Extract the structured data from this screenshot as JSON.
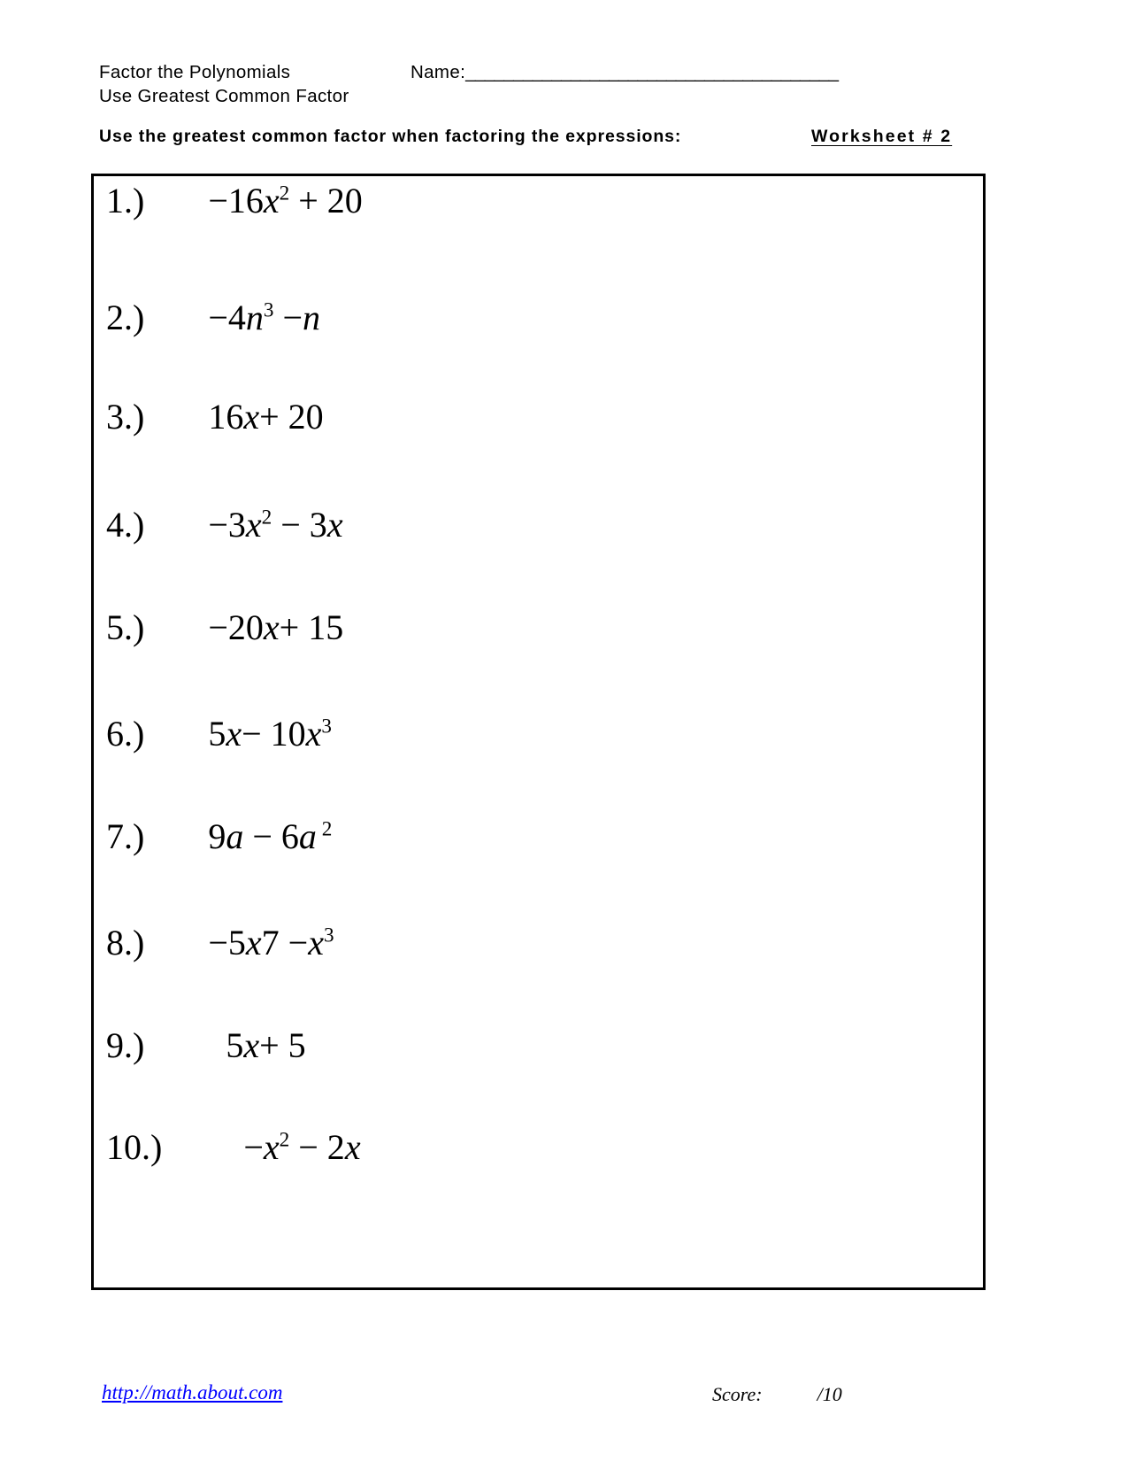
{
  "header": {
    "title_line_1": "Factor the Polynomials",
    "title_line_2": "Use Greatest Common Factor",
    "name_label": "Name:",
    "name_rule": "_______________________________________"
  },
  "instruction": {
    "text": "Use the greatest common factor when factoring the expressions:",
    "worksheet_label": "Worksheet # 2"
  },
  "problems": [
    {
      "number": "1.)",
      "expression": "−16x² + 20",
      "parts": [
        {
          "text": "−16",
          "style": "normal"
        },
        {
          "text": "x",
          "style": "italic"
        },
        {
          "text": "2",
          "style": "sup"
        },
        {
          "text": " + 20",
          "style": "normal"
        }
      ]
    },
    {
      "number": "2.)",
      "expression": "−4n³ −n",
      "parts": [
        {
          "text": "−4",
          "style": "normal"
        },
        {
          "text": "n",
          "style": "italic"
        },
        {
          "text": "3",
          "style": "sup"
        },
        {
          "text": " −",
          "style": "normal"
        },
        {
          "text": "n",
          "style": "italic"
        }
      ]
    },
    {
      "number": "3.)",
      "expression": "16x+ 20",
      "parts": [
        {
          "text": "16",
          "style": "normal"
        },
        {
          "text": "x",
          "style": "italic"
        },
        {
          "text": "+ 20",
          "style": "normal"
        }
      ]
    },
    {
      "number": "4.)",
      "expression": "−3x² − 3x",
      "parts": [
        {
          "text": "−3",
          "style": "normal"
        },
        {
          "text": "x",
          "style": "italic"
        },
        {
          "text": "2",
          "style": "sup"
        },
        {
          "text": " − 3",
          "style": "normal"
        },
        {
          "text": "x",
          "style": "italic"
        }
      ]
    },
    {
      "number": "5.)",
      "expression": "−20x+ 15",
      "parts": [
        {
          "text": "−20",
          "style": "normal"
        },
        {
          "text": "x",
          "style": "italic"
        },
        {
          "text": "+ 15",
          "style": "normal"
        }
      ]
    },
    {
      "number": "6.)",
      "expression": "5x− 10x³",
      "parts": [
        {
          "text": "5",
          "style": "normal"
        },
        {
          "text": "x",
          "style": "italic"
        },
        {
          "text": "− 10",
          "style": "normal"
        },
        {
          "text": "x",
          "style": "italic"
        },
        {
          "text": "3",
          "style": "sup"
        }
      ]
    },
    {
      "number": "7.)",
      "expression": "9a − 6a ²",
      "parts": [
        {
          "text": "9",
          "style": "normal"
        },
        {
          "text": "a",
          "style": "italic"
        },
        {
          "text": " − 6",
          "style": "normal"
        },
        {
          "text": "a",
          "style": "italic"
        },
        {
          "text": " 2",
          "style": "sup"
        }
      ]
    },
    {
      "number": "8.)",
      "expression": "−5x7 −x³",
      "parts": [
        {
          "text": "−5",
          "style": "normal"
        },
        {
          "text": "x",
          "style": "italic"
        },
        {
          "text": "7 −",
          "style": "normal"
        },
        {
          "text": "x",
          "style": "italic"
        },
        {
          "text": "3",
          "style": "sup"
        }
      ]
    },
    {
      "number": "9.)",
      "expression": "5x+ 5",
      "parts": [
        {
          "text": "5",
          "style": "normal"
        },
        {
          "text": "x",
          "style": "italic"
        },
        {
          "text": "+ 5",
          "style": "normal"
        }
      ]
    },
    {
      "number": "10.)",
      "expression": "−x² − 2x",
      "parts": [
        {
          "text": "−",
          "style": "normal"
        },
        {
          "text": "x",
          "style": "italic"
        },
        {
          "text": "2",
          "style": "sup"
        },
        {
          "text": " − 2",
          "style": "normal"
        },
        {
          "text": "x",
          "style": "italic"
        }
      ]
    }
  ],
  "footer": {
    "link_text": "http://math.about.com",
    "score_label": "Score:",
    "score_total": "/10"
  },
  "colors": {
    "link": "#0000ff",
    "text": "#000000",
    "border": "#000000",
    "background": "#ffffff"
  }
}
